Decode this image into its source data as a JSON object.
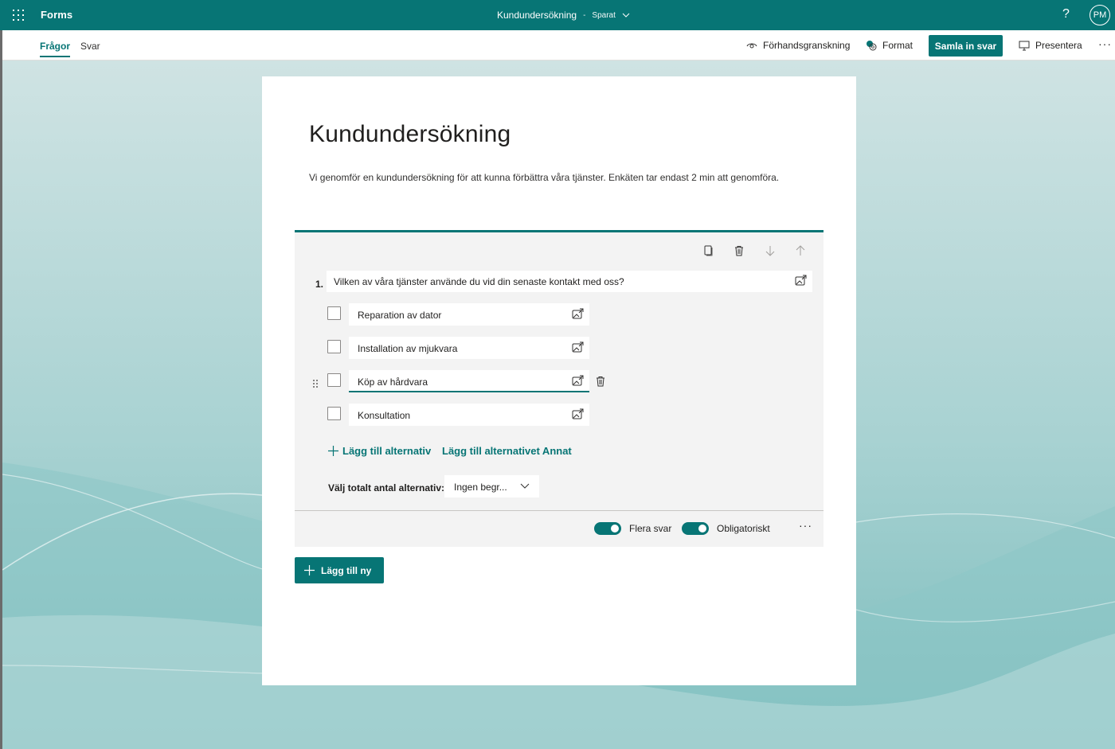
{
  "app": {
    "name": "Forms"
  },
  "document": {
    "title": "Kundundersökning",
    "separator": "-",
    "status": "Sparat"
  },
  "header": {
    "help": "?",
    "avatar_initials": "PM"
  },
  "tabs": [
    {
      "label": "Frågor",
      "active": true
    },
    {
      "label": "Svar",
      "active": false
    }
  ],
  "commands": {
    "preview": "Förhandsgranskning",
    "format": "Format",
    "collect": "Samla in svar",
    "present": "Presentera",
    "more": "···"
  },
  "form": {
    "title": "Kundundersökning",
    "description": "Vi genomför en kundundersökning för att kunna förbättra våra tjänster. Enkäten tar endast 2 min att genomföra."
  },
  "question": {
    "number": "1.",
    "text": "Vilken av våra tjänster använde du vid din senaste kontakt med oss?",
    "options": [
      {
        "label": "Reparation av dator"
      },
      {
        "label": "Installation av mjukvara"
      },
      {
        "label": "Köp av hårdvara"
      },
      {
        "label": "Konsultation"
      }
    ],
    "add_option": "Lägg till alternativ",
    "add_other": "Lägg till alternativet Annat",
    "choice_limit_label": "Välj totalt antal alternativ:",
    "choice_limit_value": "Ingen begr...",
    "multiple_answers_label": "Flera svar",
    "required_label": "Obligatoriskt",
    "more": "···"
  },
  "add_new": "Lägg till ny",
  "colors": {
    "accent": "#077575"
  }
}
